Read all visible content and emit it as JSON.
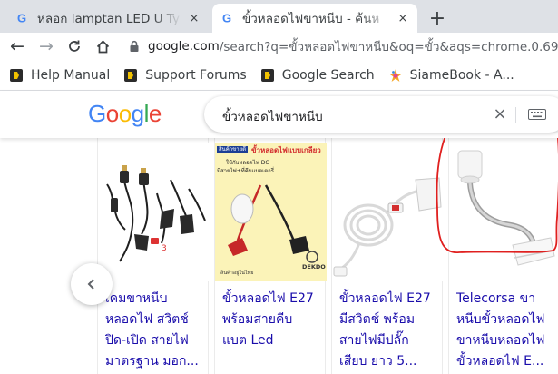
{
  "browser": {
    "tabs": [
      {
        "title": "หลอก lamptan LED U Ty",
        "close": "×",
        "active": false
      },
      {
        "title": "ขั้วหลอดไฟขาหนีบ - ค้นห",
        "close": "×",
        "active": true
      }
    ],
    "new_tab": "+",
    "nav": {
      "back": "←",
      "forward": "→",
      "reload": "C",
      "home": "⌂"
    },
    "url": {
      "host": "google.com",
      "path": "/search?q=ขั้วหลอดไฟขาหนีบ&oq=ขั้ว&aqs=chrome.0.69i59j69i57"
    },
    "bookmarks": [
      {
        "label": "Help Manual",
        "icon": "bookmark-favicon"
      },
      {
        "label": "Support Forums",
        "icon": "bookmark-favicon"
      },
      {
        "label": "Google Search",
        "icon": "bookmark-favicon"
      },
      {
        "label": "SiameBook - A...",
        "icon": "siamebook-favicon"
      }
    ]
  },
  "google": {
    "logo": [
      "G",
      "o",
      "o",
      "g",
      "l",
      "e"
    ],
    "logo_colors": [
      "#4285F4",
      "#EA4335",
      "#FBBC05",
      "#4285F4",
      "#34A853",
      "#EA4335"
    ],
    "query": "ขั้วหลอดไฟขาหนีบ",
    "clear": "×"
  },
  "results": [
    {
      "lines": [
        "เคมขาหนีบ",
        "หลอดไฟ สวิตช์",
        "ปิด-เปิด สายไฟ",
        "มาตรฐาน มอก..."
      ],
      "image": "black-cable-clips"
    },
    {
      "lines": [
        "ขั้วหลอดไฟ E27",
        "พร้อมสายคีบ",
        "แบต Led"
      ],
      "image": "socket-with-battery-clips",
      "thumb_text": {
        "badge": "สินค้าขายดี",
        "heading": "ขั้วหลอดไฟแบบเกลียว",
        "sub1": "ใช้กับหลอดไฟ DC",
        "sub2": "มีสายไฟ+ที่คีบแบตเตอรี่",
        "footer": "สินค้าอยู่ในไทย",
        "brand": "DEKDO"
      }
    },
    {
      "lines": [
        "ขั้วหลอดไฟ E27",
        "มีสวิตช์ พร้อม",
        "สายไฟมีปลั๊ก",
        "เสียบ ยาว 5..."
      ],
      "image": "white-cable-socket-switch"
    },
    {
      "lines": [
        "Telecorsa ขา",
        "หนีบขั้วหลอดไฟ",
        "ขาหนีบหลอดไฟ",
        "ขั้วหลอดไฟ E..."
      ],
      "image": "clip-lamp-holder"
    }
  ],
  "carousel": {
    "prev_icon": "chevron-left-icon"
  },
  "colors": {
    "link": "#1a0dab",
    "annotation": "#e0201f"
  }
}
